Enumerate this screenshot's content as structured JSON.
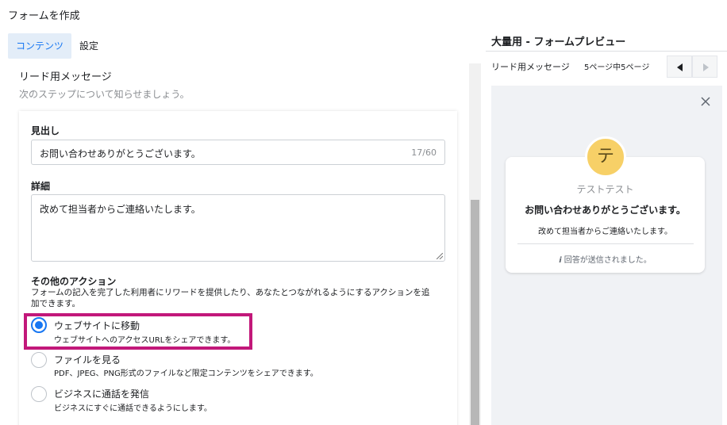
{
  "header": {
    "title": "フォームを作成"
  },
  "tabs": [
    {
      "label": "コンテンツ",
      "active": true
    },
    {
      "label": "設定",
      "active": false
    }
  ],
  "section": {
    "title": "リード用メッセージ",
    "subtitle": "次のステップについて知らせましょう。"
  },
  "form": {
    "headline": {
      "label": "見出し",
      "value": "お問い合わせありがとうございます。",
      "counter": "17/60"
    },
    "details": {
      "label": "詳細",
      "value": "改めて担当者からご連絡いたします。"
    },
    "actions": {
      "label": "その他のアクション",
      "description_line1": "フォームの記入を完了した利用者にリワードを提供したり、あなたとつながれるようにするアクションを追",
      "description_line2": "加できます。",
      "options": [
        {
          "label": "ウェブサイトに移動",
          "sub": "ウェブサイトへのアクセスURLをシェアできます。",
          "checked": true
        },
        {
          "label": "ファイルを見る",
          "sub": "PDF、JPEG、PNG形式のファイルなど限定コンテンツをシェアできます。",
          "checked": false
        },
        {
          "label": "ビジネスに通話を発信",
          "sub": "ビジネスにすぐに通話できるようにします。",
          "checked": false
        }
      ]
    }
  },
  "preview": {
    "title": "大量用 - フォームプレビュー",
    "toolbar_label": "リード用メッセージ",
    "page_indicator": "5ページ中5ページ",
    "avatar_letter": "テ",
    "page_name": "テストテスト",
    "headline": "お問い合わせありがとうございます。",
    "detail": "改めて担当者からご連絡いたします。",
    "info_glyph": "i",
    "sent": "回答が送信されました。"
  },
  "colors": {
    "accent": "#1877f2",
    "highlight": "#c2187a",
    "avatar": "#f7d067"
  }
}
